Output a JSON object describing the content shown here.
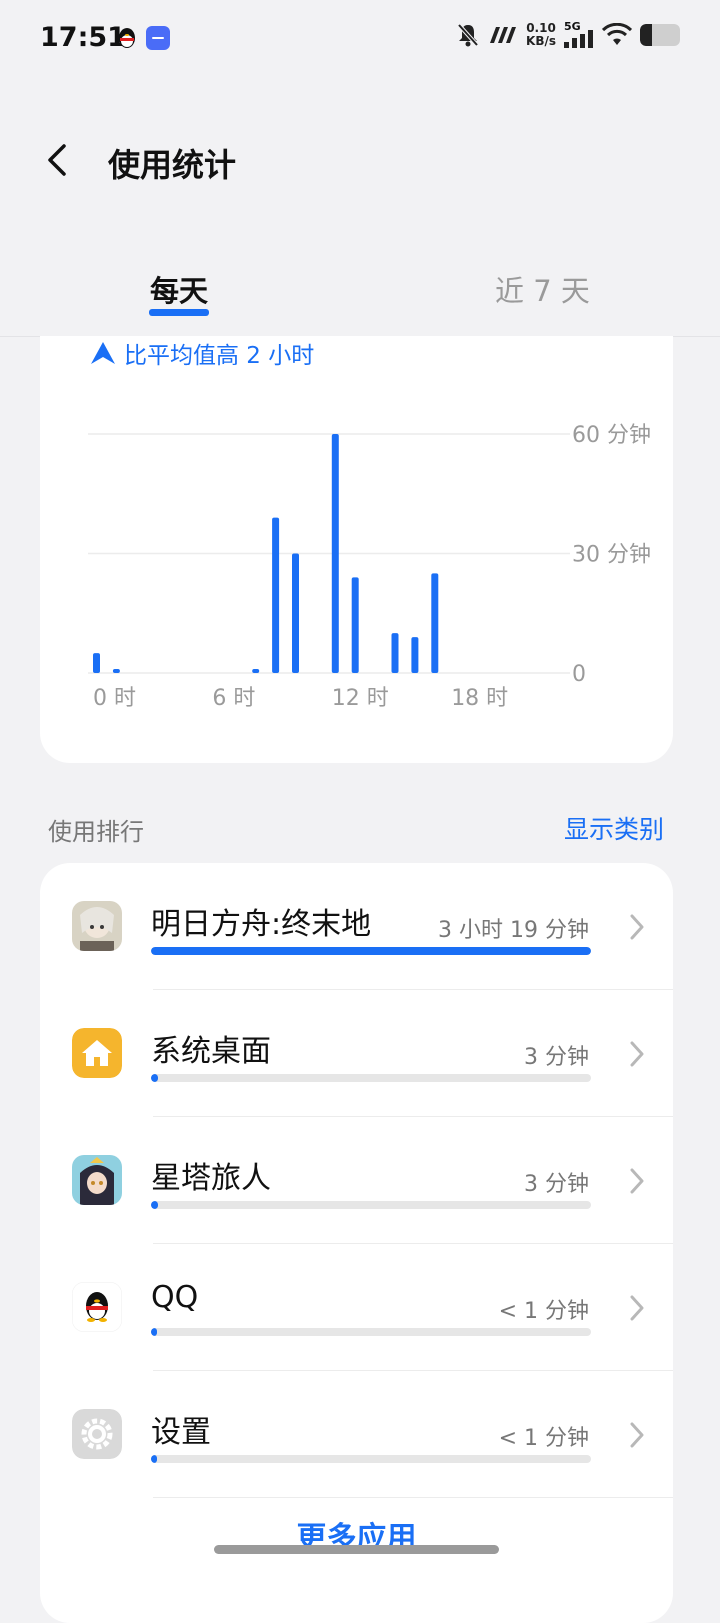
{
  "status_bar": {
    "time": "17:51",
    "net_speed_value": "0.10",
    "net_speed_unit": "KB/s",
    "network": "5G",
    "battery_level": 0.3
  },
  "header": {
    "title": "使用统计"
  },
  "tabs": [
    {
      "label": "每天",
      "active": true
    },
    {
      "label": "近 7 天",
      "active": false
    }
  ],
  "trend": {
    "text": "比平均值高 2 小时"
  },
  "chart_data": {
    "type": "bar",
    "x": [
      0,
      1,
      2,
      3,
      4,
      5,
      6,
      7,
      8,
      9,
      10,
      11,
      12,
      13,
      14,
      15,
      16,
      17,
      18,
      19,
      20,
      21,
      22,
      23
    ],
    "values": [
      5,
      1,
      0,
      0,
      0,
      0,
      0,
      0,
      1,
      39,
      30,
      0,
      60,
      24,
      0,
      10,
      9,
      25,
      0,
      0,
      0,
      0,
      0,
      0
    ],
    "x_tick_labels": [
      "0 时",
      "6 时",
      "12 时",
      "18 时"
    ],
    "y_tick_labels": [
      "60 分钟",
      "30 分钟",
      "0"
    ],
    "ylim": [
      0,
      60
    ],
    "grid": true,
    "color": "#1a6ff5"
  },
  "ranking": {
    "label": "使用排行",
    "toggle": "显示类别",
    "more": "更多应用",
    "items": [
      {
        "name": "明日方舟:终末地",
        "duration": "3 小时 19 分钟",
        "share": 1.0,
        "icon": "arknights-endfield-icon"
      },
      {
        "name": "系统桌面",
        "duration": "3 分钟",
        "share": 0.015,
        "icon": "home-launcher-icon"
      },
      {
        "name": "星塔旅人",
        "duration": "3 分钟",
        "share": 0.015,
        "icon": "star-tower-traveler-icon"
      },
      {
        "name": "QQ",
        "duration": "< 1 分钟",
        "share": 0.005,
        "icon": "qq-penguin-icon"
      },
      {
        "name": "设置",
        "duration": "< 1 分钟",
        "share": 0.005,
        "icon": "settings-gear-icon"
      }
    ]
  }
}
